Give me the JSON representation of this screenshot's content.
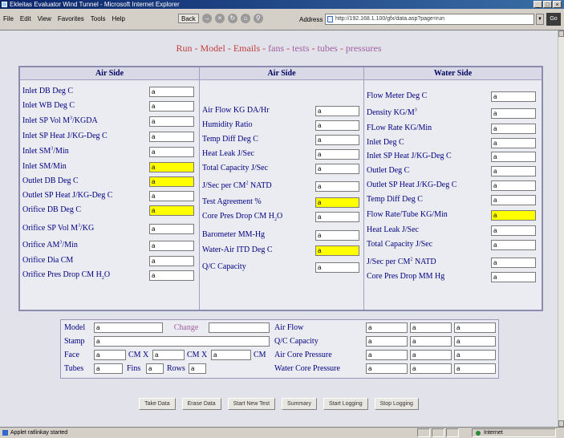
{
  "window": {
    "title": "Ekleitas Evaluator Wind Tunnel - Microsoft Internet Explorer",
    "controls": [
      "_",
      "□",
      "×"
    ]
  },
  "menu": [
    "File",
    "Edit",
    "View",
    "Favorites",
    "Tools",
    "Help"
  ],
  "toolbar": {
    "back_label": "Back",
    "address_label": "Address",
    "address_value": "http://192.168.1.100/gfx/data.asp?page=run",
    "go_label": "Go"
  },
  "nav": {
    "links": [
      "Run",
      "Model",
      "Emails",
      "fans",
      "tests",
      "tubes",
      "pressures"
    ]
  },
  "panels": {
    "air1": {
      "header": "Air Side",
      "rows": [
        {
          "label": "Inlet DB Deg C",
          "value": "a",
          "highlight": false
        },
        {
          "label": "Inlet WB Deg C",
          "value": "a",
          "highlight": false
        },
        {
          "label": "Inlet SP Vol M",
          "sup": "3",
          "label_tail": "/KGDA",
          "value": "a",
          "highlight": false
        },
        {
          "label": "Inlet SP Heat J/KG-Deg C",
          "value": "a",
          "highlight": false
        },
        {
          "label": "Inlet SM",
          "sup": "3",
          "label_tail": "/Min",
          "value": "a",
          "highlight": false
        },
        {
          "label": "Inlet SM/Min",
          "value": "a",
          "highlight": true
        },
        {
          "label": "Outlet DB Deg C",
          "value": "a",
          "highlight": true
        },
        {
          "label": "Outlet SP Heat J/KG-Deg C",
          "value": "a",
          "highlight": false
        },
        {
          "label": "Orifice DB Deg C",
          "value": "a",
          "highlight": true
        },
        {
          "label": "Orifice SP Vol M",
          "sup": "3",
          "label_tail": "/KG",
          "value": "a",
          "highlight": false
        },
        {
          "label": "Orifice AM",
          "sup": "3",
          "label_tail": "/Min",
          "value": "a",
          "highlight": false
        },
        {
          "label": "Orifice Dia CM",
          "value": "a",
          "highlight": false
        },
        {
          "label": "Orifice Pres Drop CM H",
          "sub": "2",
          "label_tail": "O",
          "value": "a",
          "highlight": false
        }
      ]
    },
    "air2": {
      "header": "Air Side",
      "rows": [
        {
          "label": "Air Flow KG DA/Hr",
          "value": "a",
          "highlight": false
        },
        {
          "label": "Humidity Ratio",
          "value": "a",
          "highlight": false
        },
        {
          "label": "Temp Diff Deg C",
          "value": "a",
          "highlight": false
        },
        {
          "label": "Heat Leak J/Sec",
          "value": "a",
          "highlight": false
        },
        {
          "label": "Total Capacity J/Sec",
          "value": "a",
          "highlight": false
        },
        {
          "label": "J/Sec per CM",
          "sup": "2",
          "label_tail": " NATD",
          "value": "a",
          "highlight": false
        },
        {
          "label": "Test Agreement %",
          "value": "a",
          "highlight": true
        },
        {
          "label": "Core Pres Drop CM H",
          "sub": "2",
          "label_tail": "O",
          "value": "a",
          "highlight": false
        },
        {
          "label": "Barometer MM-Hg",
          "value": "a",
          "highlight": false
        },
        {
          "label": "Water-Air ITD Deg C",
          "value": "a",
          "highlight": true
        },
        {
          "label": "Q/C Capacity",
          "value": "a",
          "highlight": false
        }
      ]
    },
    "water": {
      "header": "Water Side",
      "rows": [
        {
          "label": "Flow Meter Deg C",
          "value": "a",
          "highlight": false
        },
        {
          "label": "Density KG/M",
          "sup": "3",
          "label_tail": "",
          "value": "a",
          "highlight": false
        },
        {
          "label": "FLow Rate KG/Min",
          "value": "a",
          "highlight": false
        },
        {
          "label": "Inlet Deg C",
          "value": "a",
          "highlight": false
        },
        {
          "label": "Inlet SP Heat J/KG-Deg C",
          "value": "a",
          "highlight": false
        },
        {
          "label": "Outlet Deg C",
          "value": "a",
          "highlight": false
        },
        {
          "label": "Outlet SP Heat J/KG-Deg C",
          "value": "a",
          "highlight": false
        },
        {
          "label": "Temp Diff Deg C",
          "value": "a",
          "highlight": false
        },
        {
          "label": "Flow Rate/Tube KG/Min",
          "value": "a",
          "highlight": true
        },
        {
          "label": "Heat Leak J/Sec",
          "value": "a",
          "highlight": false
        },
        {
          "label": "Total Capacity J/Sec",
          "value": "a",
          "highlight": false
        },
        {
          "label": "J/Sec per CM",
          "sup": "2",
          "label_tail": " NATD",
          "value": "a",
          "highlight": false
        },
        {
          "label": "Core Pres Drop MM Hg",
          "value": "a",
          "highlight": false
        }
      ]
    }
  },
  "lower": {
    "model_label": "Model",
    "model_value": "a",
    "change_label": "Change",
    "stamp_label": "Stamp",
    "stamp_value": "a",
    "face_label": "Face",
    "face_value": "a",
    "cm_x1": "CM X",
    "face_value2": "a",
    "cm_x2": "CM X",
    "face_value3": "a",
    "cm_end": "CM",
    "tubes_label": "Tubes",
    "tubes_value": "a",
    "fins_label": "Fins",
    "fins_value": "a",
    "rows_label": "Rows",
    "rows_value": "a",
    "right_rows": [
      {
        "label": "Air Flow",
        "values": [
          "a",
          "a",
          "a"
        ]
      },
      {
        "label": "Q/C Capacity",
        "values": [
          "a",
          "a",
          "a"
        ]
      },
      {
        "label": "Air Core Pressure",
        "values": [
          "a",
          "a",
          "a"
        ]
      },
      {
        "label": "Water Core Pressure",
        "values": [
          "a",
          "a",
          "a"
        ]
      }
    ]
  },
  "buttons": [
    "Take Data",
    "Erase Data",
    "Start New Test",
    "Summary",
    "Start Logging",
    "Stop Logging"
  ],
  "status": {
    "text": "Applet ratlinkay started",
    "zone": "Internet"
  },
  "colors": {
    "highlight": "#ffff00",
    "nav_link": "#c04040",
    "label_text": "#000080",
    "panel_border": "#8c8cb0"
  }
}
